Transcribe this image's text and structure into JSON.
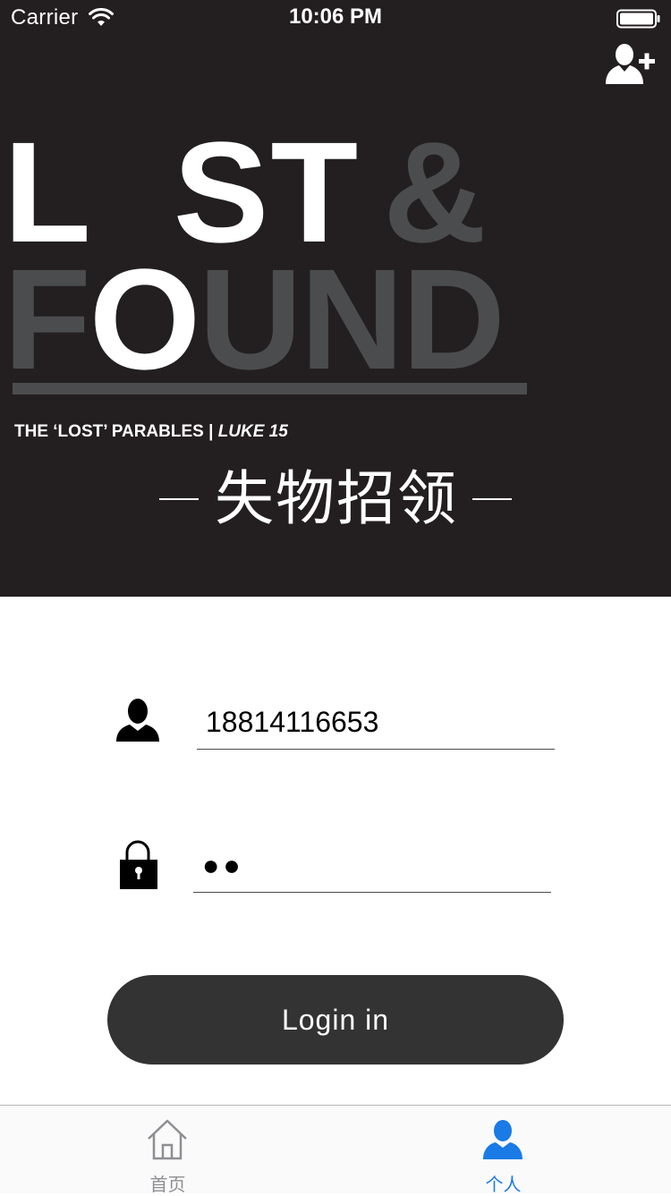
{
  "status_bar": {
    "carrier": "Carrier",
    "time": "10:06 PM"
  },
  "header": {
    "add_user_icon": "add-user-icon",
    "logo": {
      "line1": "L  ST &",
      "line2": "FOUND",
      "tagline_main": "THE ‘LOST’ PARABLES | ",
      "tagline_italic": "LUKE 15"
    },
    "subtitle": "失物招领"
  },
  "form": {
    "username_icon": "user-icon",
    "username_value": "18814116653",
    "password_icon": "lock-icon",
    "password_value": "●●",
    "login_label": "Login in"
  },
  "tab_bar": {
    "tabs": [
      {
        "label": "首页",
        "icon": "home-icon",
        "active": false
      },
      {
        "label": "个人",
        "icon": "person-icon",
        "active": true
      }
    ]
  },
  "colors": {
    "hero_background": "#231f20",
    "logo_grey": "#4b4c4e",
    "button_background": "#333333",
    "active_tab": "#1a7ae6",
    "inactive_tab": "#8e8e93"
  }
}
